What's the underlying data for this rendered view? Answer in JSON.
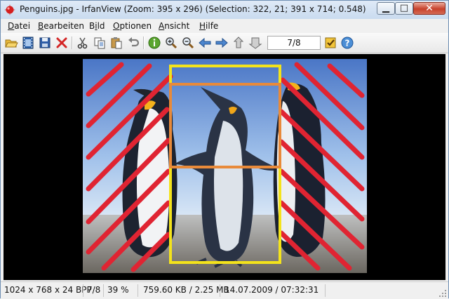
{
  "window": {
    "title": "Penguins.jpg - IrfanView (Zoom: 395 x 296)  (Selection: 322, 21; 391 x 714; 0.548)"
  },
  "menu": {
    "items": [
      "Datei",
      "Bearbeiten",
      "Bild",
      "Optionen",
      "Ansicht",
      "Hilfe"
    ],
    "mnemonics": [
      "D",
      "B",
      "i",
      "O",
      "A",
      "H"
    ]
  },
  "toolbar": {
    "page_indicator": "7/8"
  },
  "status": {
    "dimensions": "1024 x 768 x 24 BPP",
    "index": "7/8",
    "zoom": "39 %",
    "filesize": "759.60 KB / 2.25 MB",
    "datetime": "14.07.2009 / 07:32:31"
  },
  "colors": {
    "hatch": "#e02432",
    "selection_outer": "#f4e31b",
    "selection_inner": "#e88a3a"
  }
}
